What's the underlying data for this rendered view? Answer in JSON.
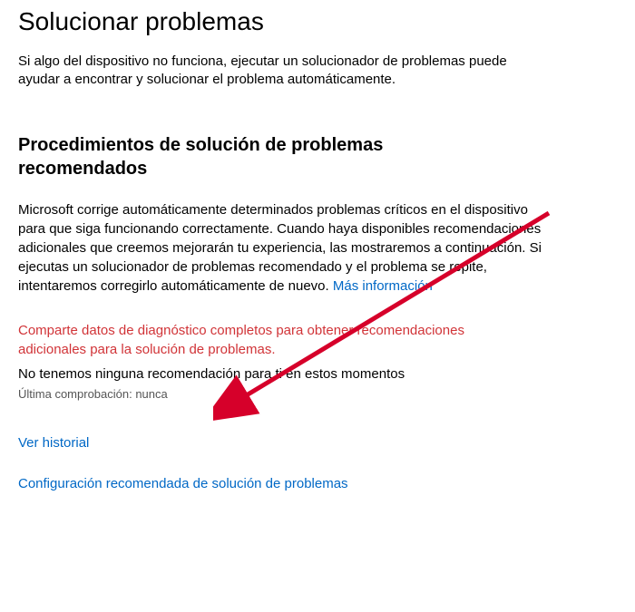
{
  "page": {
    "title": "Solucionar problemas",
    "intro": "Si algo del dispositivo no funciona, ejecutar un solucionador de problemas puede ayudar a encontrar y solucionar el problema automáticamente."
  },
  "recommended": {
    "heading": "Procedimientos de solución de problemas recomendados",
    "body": "Microsoft corrige automáticamente determinados problemas críticos en el dispositivo para que siga funcionando correctamente. Cuando haya disponibles recomendaciones adicionales que creemos mejorarán tu experiencia, las mostraremos a continuación. Si ejecutas un solucionador de problemas recomendado y el problema se repite, intentaremos corregirlo automáticamente de nuevo. ",
    "more_info_label": "Más información",
    "warning_link": "Comparte datos de diagnóstico completos para obtener recomendaciones adicionales para la solución de problemas.",
    "no_recommendations": "No tenemos ninguna recomendación para ti en estos momentos",
    "last_check": "Última comprobación: nunca"
  },
  "links": {
    "history": "Ver historial",
    "recommended_config": "Configuración recomendada de solución de problemas"
  },
  "colors": {
    "link": "#0068c6",
    "warning": "#d13438",
    "arrow": "#d6002a"
  }
}
